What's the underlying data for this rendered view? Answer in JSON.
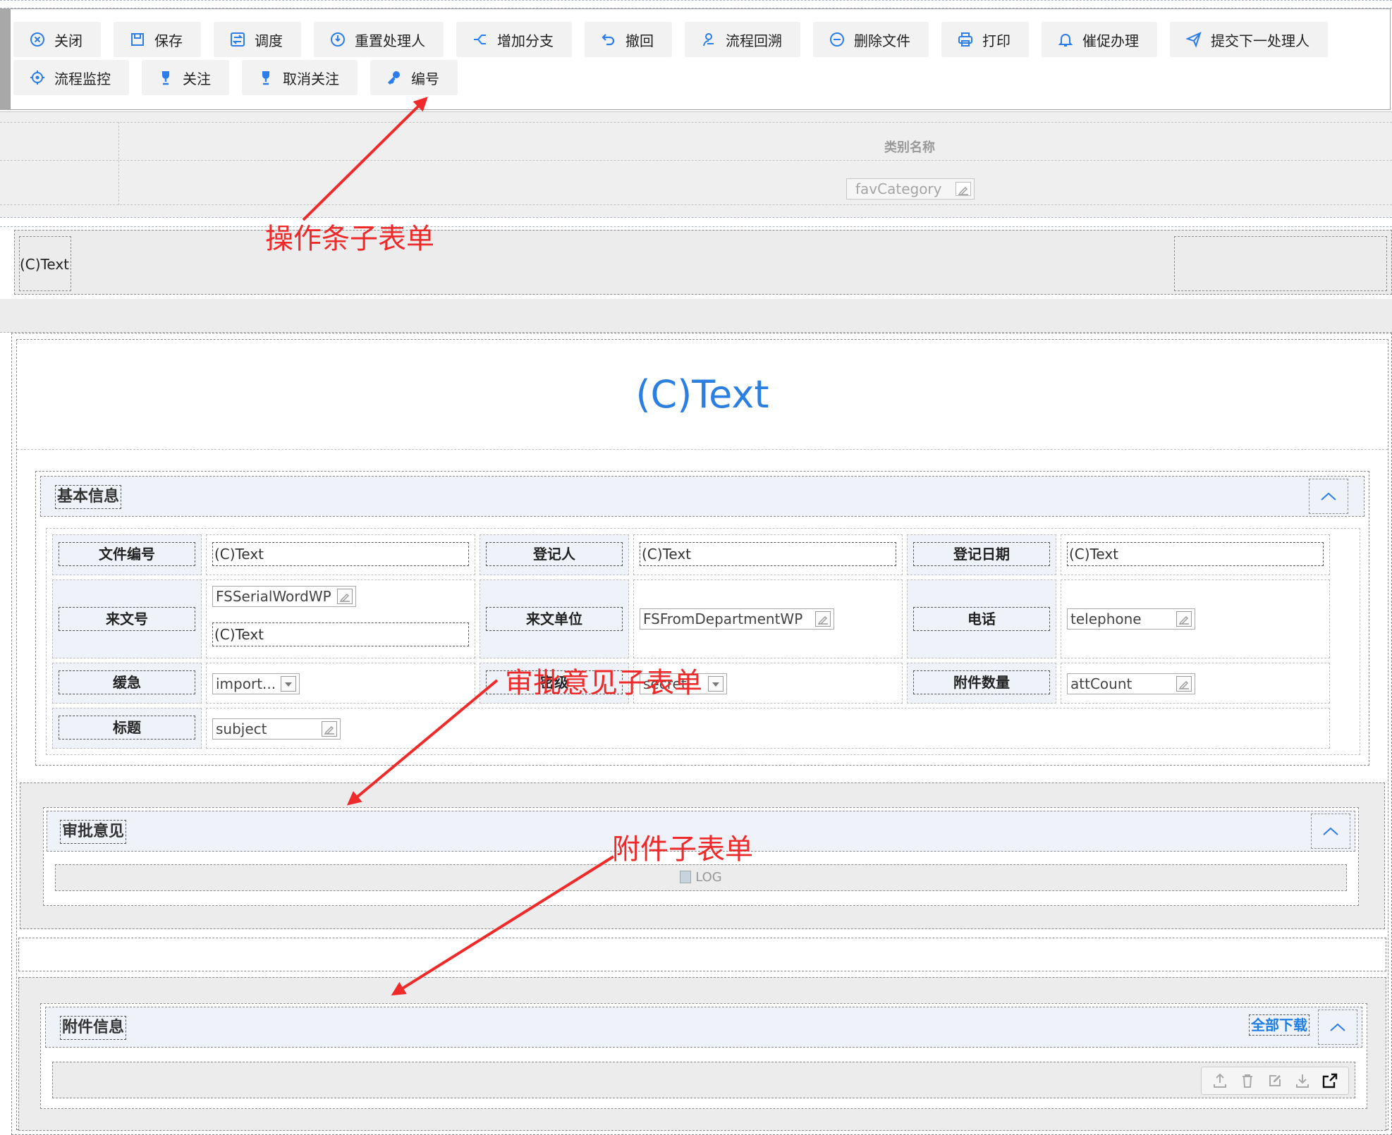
{
  "toolbar": {
    "row1": [
      {
        "label": "关闭",
        "icon": "close-circle-icon"
      },
      {
        "label": "保存",
        "icon": "save-icon"
      },
      {
        "label": "调度",
        "icon": "dispatch-icon"
      },
      {
        "label": "重置处理人",
        "icon": "reset-handler-icon"
      },
      {
        "label": "增加分支",
        "icon": "branch-icon"
      },
      {
        "label": "撤回",
        "icon": "undo-icon"
      },
      {
        "label": "流程回溯",
        "icon": "trace-icon"
      },
      {
        "label": "删除文件",
        "icon": "minus-circle-icon"
      },
      {
        "label": "打印",
        "icon": "print-icon"
      },
      {
        "label": "催促办理",
        "icon": "bell-icon"
      },
      {
        "label": "提交下一处理人",
        "icon": "send-icon"
      }
    ],
    "row2": [
      {
        "label": "流程监控",
        "icon": "monitor-icon"
      },
      {
        "label": "关注",
        "icon": "trophy-icon"
      },
      {
        "label": "取消关注",
        "icon": "trophy-icon"
      },
      {
        "label": "编号",
        "icon": "key-icon"
      }
    ]
  },
  "category": {
    "header": "类别名称",
    "field_value": "favCategory"
  },
  "strip": {
    "left_text": "(C)Text"
  },
  "form": {
    "title": "(C)Text",
    "basic_info": {
      "title": "基本信息",
      "rows": [
        [
          {
            "label": "文件编号",
            "value": "(C)Text"
          },
          {
            "label": "登记人",
            "value": "(C)Text"
          },
          {
            "label": "登记日期",
            "value": "(C)Text"
          }
        ]
      ],
      "doc_no_label": "来文号",
      "doc_no_field": "FSSerialWordWP",
      "doc_no_text": "(C)Text",
      "from_dept_label": "来文单位",
      "from_dept_field": "FSFromDepartmentWP",
      "phone_label": "电话",
      "phone_field": "telephone",
      "urgency_label": "缓急",
      "urgency_field": "import...",
      "secret_label": "密级",
      "secret_field": "secret",
      "att_count_label": "附件数量",
      "att_count_field": "attCount",
      "subject_label": "标题",
      "subject_field": "subject"
    },
    "approval": {
      "title": "审批意见",
      "log_label": "LOG"
    },
    "attachments": {
      "title": "附件信息",
      "download_all": "全部下载"
    }
  },
  "annotations": {
    "toolbar_sub": "操作条子表单",
    "approval_sub": "审批意见子表单",
    "attachment_sub": "附件子表单"
  },
  "colors": {
    "accent": "#2b7de9",
    "annotation": "#ee2a2a",
    "title_blue": "#2a7fe0"
  }
}
